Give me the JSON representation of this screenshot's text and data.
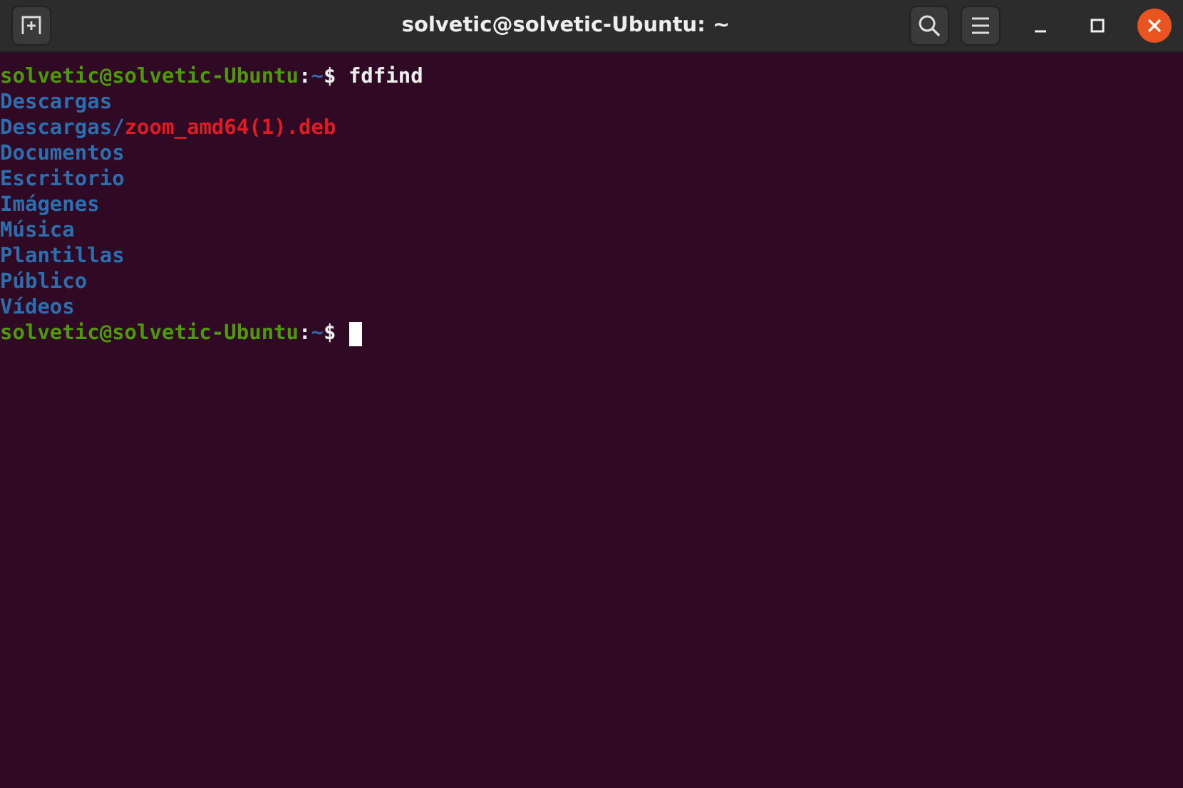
{
  "window": {
    "title": "solvetic@solvetic-Ubuntu: ~"
  },
  "terminal": {
    "lines": [
      {
        "cursor": false,
        "segments": [
          {
            "kind": "user_host",
            "text": "solvetic@solvetic-Ubuntu"
          },
          {
            "kind": "plain",
            "text": ":"
          },
          {
            "kind": "path",
            "text": "~"
          },
          {
            "kind": "plain",
            "text": "$ fdfind"
          }
        ]
      },
      {
        "cursor": false,
        "segments": [
          {
            "kind": "directory",
            "text": "Descargas"
          }
        ]
      },
      {
        "cursor": false,
        "segments": [
          {
            "kind": "directory",
            "text": "Descargas/"
          },
          {
            "kind": "archive",
            "text": "zoom_amd64(1).deb"
          }
        ]
      },
      {
        "cursor": false,
        "segments": [
          {
            "kind": "directory",
            "text": "Documentos"
          }
        ]
      },
      {
        "cursor": false,
        "segments": [
          {
            "kind": "directory",
            "text": "Escritorio"
          }
        ]
      },
      {
        "cursor": false,
        "segments": [
          {
            "kind": "directory",
            "text": "Imágenes"
          }
        ]
      },
      {
        "cursor": false,
        "segments": [
          {
            "kind": "directory",
            "text": "Música"
          }
        ]
      },
      {
        "cursor": false,
        "segments": [
          {
            "kind": "directory",
            "text": "Plantillas"
          }
        ]
      },
      {
        "cursor": false,
        "segments": [
          {
            "kind": "directory",
            "text": "Público"
          }
        ]
      },
      {
        "cursor": false,
        "segments": [
          {
            "kind": "directory",
            "text": "Vídeos"
          }
        ]
      },
      {
        "cursor": true,
        "segments": [
          {
            "kind": "user_host",
            "text": "solvetic@solvetic-Ubuntu"
          },
          {
            "kind": "plain",
            "text": ":"
          },
          {
            "kind": "path",
            "text": "~"
          },
          {
            "kind": "plain",
            "text": "$"
          }
        ]
      }
    ]
  }
}
